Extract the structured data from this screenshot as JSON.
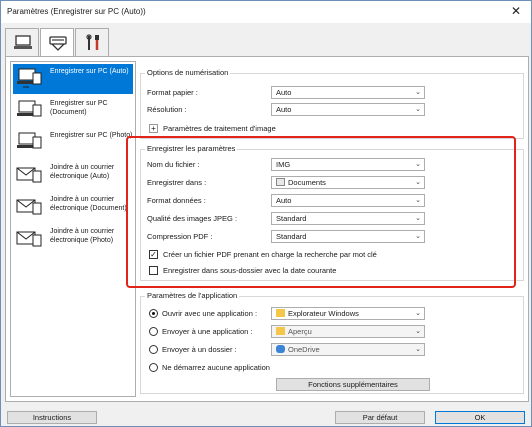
{
  "window": {
    "title": "Paramètres (Enregistrer sur PC (Auto))",
    "close_glyph": "✕"
  },
  "tabs": [
    {
      "icon": "computer-scan-icon",
      "active": false
    },
    {
      "icon": "scanner-icon",
      "active": true
    },
    {
      "icon": "tools-icon",
      "active": false
    }
  ],
  "sidebar": {
    "items": [
      {
        "label": "Enregistrer sur PC (Auto)",
        "selected": true,
        "icon": "save-to-pc-icon"
      },
      {
        "label": "Enregistrer sur PC (Document)",
        "selected": false,
        "icon": "save-to-pc-icon"
      },
      {
        "label": "Enregistrer sur PC (Photo)",
        "selected": false,
        "icon": "save-to-pc-icon"
      },
      {
        "label": "Joindre à un courrier électronique (Auto)",
        "selected": false,
        "icon": "email-attach-icon"
      },
      {
        "label": "Joindre à un courrier électronique (Document)",
        "selected": false,
        "icon": "email-attach-icon"
      },
      {
        "label": "Joindre à un courrier électronique (Photo)",
        "selected": false,
        "icon": "email-attach-icon"
      }
    ]
  },
  "scan_options": {
    "legend": "Options de numérisation",
    "paper_size_label": "Format papier :",
    "paper_size_value": "Auto",
    "resolution_label": "Résolution :",
    "resolution_value": "Auto",
    "image_processing_label": "Paramètres de traitement d'image"
  },
  "save_settings": {
    "legend": "Enregistrer les paramètres",
    "file_name_label": "Nom du fichier :",
    "file_name_value": "IMG",
    "save_in_label": "Enregistrer dans :",
    "save_in_value": "Documents",
    "data_format_label": "Format données :",
    "data_format_value": "Auto",
    "jpeg_quality_label": "Qualité des images JPEG :",
    "jpeg_quality_value": "Standard",
    "pdf_compression_label": "Compression PDF :",
    "pdf_compression_value": "Standard",
    "searchable_pdf_label": "Créer un fichier PDF prenant en charge la recherche par mot clé",
    "searchable_pdf_checked": true,
    "subfolder_label": "Enregistrer dans sous-dossier avec la date courante",
    "subfolder_checked": false,
    "check_glyph": "✓"
  },
  "app_settings": {
    "legend": "Paramètres de l'application",
    "open_app_label": "Ouvrir avec une application :",
    "open_app_value": "Explorateur Windows",
    "send_app_label": "Envoyer à une application :",
    "send_app_value": "Aperçu",
    "send_folder_label": "Envoyer à un dossier :",
    "send_folder_value": "OneDrive",
    "no_app_label": "Ne démarrez aucune application",
    "selected_option": "open_app",
    "extra_functions_label": "Fonctions supplémentaires"
  },
  "footer": {
    "instructions_label": "Instructions",
    "defaults_label": "Par défaut",
    "ok_label": "OK"
  },
  "colors": {
    "selection": "#0078d7",
    "highlight_border": "#e2231a"
  },
  "dropdown_arrow": "⌄"
}
